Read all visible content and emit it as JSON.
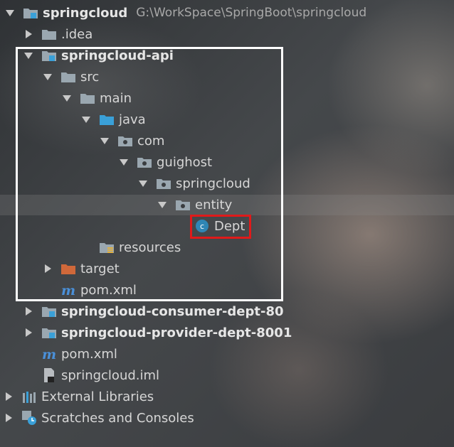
{
  "tree": [
    {
      "name": "springcloud",
      "path": "G:\\WorkSpace\\SpringBoot\\springcloud",
      "icon": "module-folder-icon",
      "bold": true,
      "arrow": "expanded"
    },
    {
      "name": ".idea",
      "icon": "folder-icon",
      "arrow": "collapsed"
    },
    {
      "name": "springcloud-api",
      "icon": "module-folder-icon",
      "bold": true,
      "arrow": "expanded"
    },
    {
      "name": "src",
      "icon": "folder-icon",
      "arrow": "expanded"
    },
    {
      "name": "main",
      "icon": "folder-icon",
      "arrow": "expanded"
    },
    {
      "name": "java",
      "icon": "source-folder-icon",
      "arrow": "expanded"
    },
    {
      "name": "com",
      "icon": "package-icon",
      "arrow": "expanded"
    },
    {
      "name": "guighost",
      "icon": "package-icon",
      "arrow": "expanded"
    },
    {
      "name": "springcloud",
      "icon": "package-icon",
      "arrow": "expanded"
    },
    {
      "name": "entity",
      "icon": "package-icon",
      "arrow": "expanded"
    },
    {
      "name": "Dept",
      "icon": "class-icon",
      "arrow": "none"
    },
    {
      "name": "resources",
      "icon": "resources-folder-icon",
      "arrow": "none"
    },
    {
      "name": "target",
      "icon": "excluded-folder-icon",
      "arrow": "collapsed"
    },
    {
      "name": "pom.xml",
      "icon": "maven-icon",
      "arrow": "none"
    },
    {
      "name": "springcloud-consumer-dept-80",
      "icon": "module-folder-icon",
      "bold": true,
      "arrow": "collapsed"
    },
    {
      "name": "springcloud-provider-dept-8001",
      "icon": "module-folder-icon",
      "bold": true,
      "arrow": "collapsed"
    },
    {
      "name": "pom.xml",
      "icon": "maven-icon",
      "arrow": "none"
    },
    {
      "name": "springcloud.iml",
      "icon": "iml-file-icon",
      "arrow": "none"
    },
    {
      "name": "External Libraries",
      "icon": "libraries-icon",
      "arrow": "collapsed"
    },
    {
      "name": "Scratches and Consoles",
      "icon": "scratches-icon",
      "arrow": "collapsed"
    }
  ],
  "colors": {
    "highlight_box": "#ffffff",
    "selected_box": "#e01a1a",
    "package": "#9aa7b0",
    "source_folder": "#3aa0d8",
    "excluded_folder": "#d0683a",
    "maven": "#4a90d9",
    "class": "#2f86b5"
  }
}
